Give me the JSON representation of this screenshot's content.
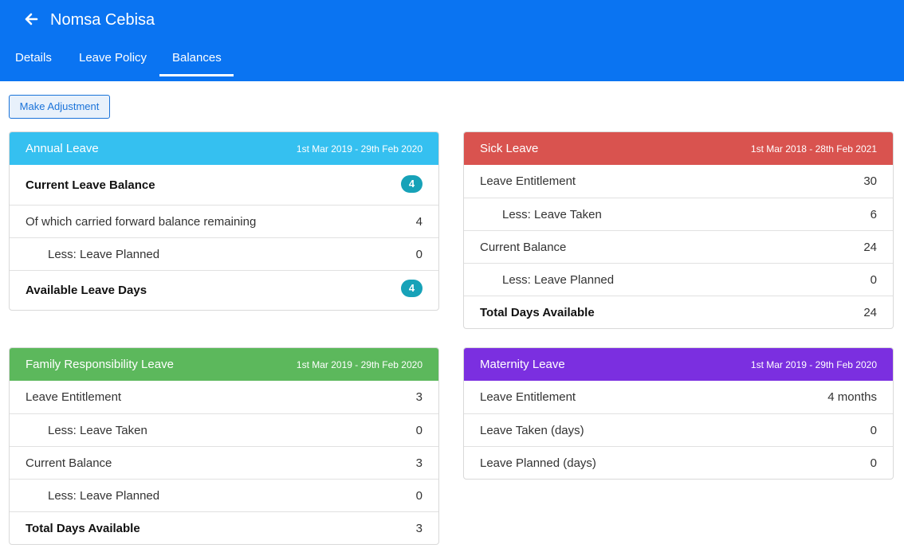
{
  "header": {
    "title": "Nomsa Cebisa",
    "tabs": [
      "Details",
      "Leave Policy",
      "Balances"
    ],
    "active_tab": "Balances",
    "color": "#0a74f2"
  },
  "actions": {
    "adjust_label": "Make Adjustment"
  },
  "cards": {
    "annual": {
      "title": "Annual Leave",
      "dates": "1st Mar 2019 - 29th Feb 2020",
      "color": "#35c0f0",
      "rows": [
        {
          "label": "Current Leave Balance",
          "value": "4"
        },
        {
          "label": "Of which carried forward balance remaining",
          "value": "4"
        },
        {
          "label": "Less: Leave Planned",
          "value": "0"
        },
        {
          "label": "Available Leave Days",
          "value": "4"
        }
      ]
    },
    "sick": {
      "title": "Sick Leave",
      "dates": "1st Mar 2018 - 28th Feb 2021",
      "color": "#d9534f",
      "rows": [
        {
          "label": "Leave Entitlement",
          "value": "30"
        },
        {
          "label": "Less: Leave Taken",
          "value": "6"
        },
        {
          "label": "Current Balance",
          "value": "24"
        },
        {
          "label": "Less: Leave Planned",
          "value": "0"
        },
        {
          "label": "Total Days Available",
          "value": "24"
        }
      ]
    },
    "family": {
      "title": "Family Responsibility Leave",
      "dates": "1st Mar 2019 - 29th Feb 2020",
      "color": "#5cb85c",
      "rows": [
        {
          "label": "Leave Entitlement",
          "value": "3"
        },
        {
          "label": "Less: Leave Taken",
          "value": "0"
        },
        {
          "label": "Current Balance",
          "value": "3"
        },
        {
          "label": "Less: Leave Planned",
          "value": "0"
        },
        {
          "label": "Total Days Available",
          "value": "3"
        }
      ]
    },
    "maternity": {
      "title": "Maternity Leave",
      "dates": "1st Mar 2019 - 29th Feb 2020",
      "color": "#7b2fe0",
      "rows": [
        {
          "label": "Leave Entitlement",
          "value": "4 months"
        },
        {
          "label": "Leave Taken (days)",
          "value": "0"
        },
        {
          "label": "Leave Planned (days)",
          "value": "0"
        }
      ]
    }
  }
}
